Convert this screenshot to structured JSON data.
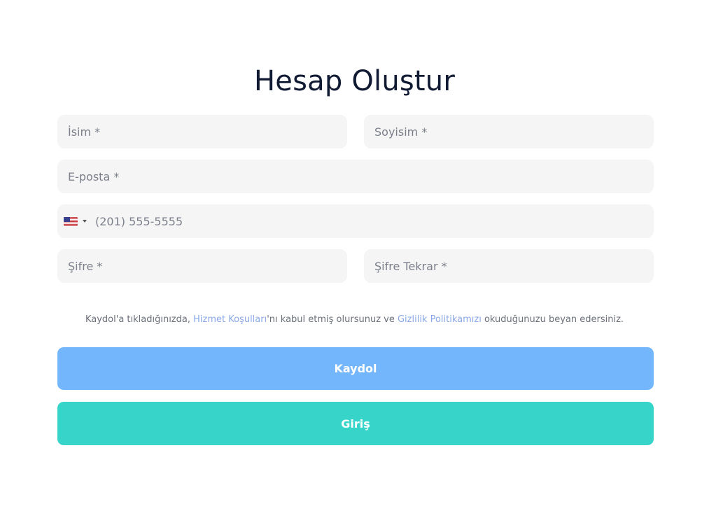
{
  "title": "Hesap Oluştur",
  "form": {
    "first_name_placeholder": "İsim *",
    "last_name_placeholder": "Soyisim *",
    "email_placeholder": "E-posta *",
    "phone_placeholder": "(201) 555-5555",
    "phone_country": "us-flag-icon",
    "password_placeholder": "Şifre *",
    "password_repeat_placeholder": "Şifre Tekrar *"
  },
  "terms": {
    "prefix": "Kaydol'a tıkladığınızda, ",
    "service_link": "Hizmet Koşulları",
    "middle": "'nı kabul etmiş olursunuz ve ",
    "privacy_link": "Gizlilik Politikamızı",
    "suffix": " okuduğunuzu beyan edersiniz."
  },
  "buttons": {
    "register_label": "Kaydol",
    "login_label": "Giriş"
  },
  "colors": {
    "register_button": "#74b6fb",
    "login_button": "#37d4ca",
    "input_background": "#f5f5f5",
    "link": "#8aa8e8"
  }
}
